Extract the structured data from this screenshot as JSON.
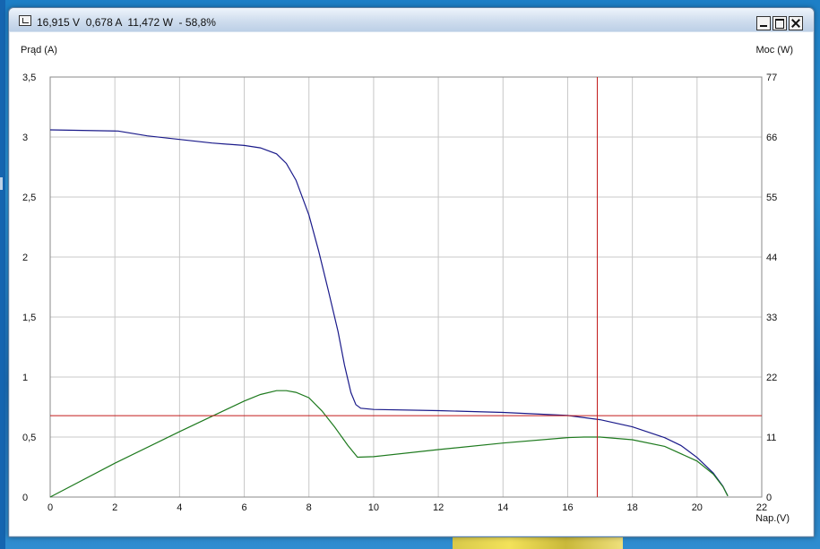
{
  "window": {
    "title": "16,915 V  0,678 A  11,472 W  - 58,8%"
  },
  "colors": {
    "current_curve": "#1a1a8a",
    "power_curve": "#1e7a1e",
    "cursor": "#c21a1a",
    "grid": "#c8c8c8",
    "axis": "#888888"
  },
  "chart_data": {
    "type": "line",
    "xlabel": "Nap.(V)",
    "ylabel_left": "Prąd (A)",
    "ylabel_right": "Moc (W)",
    "xlim": [
      0,
      22
    ],
    "ylim_left": [
      0,
      3.5
    ],
    "ylim_right": [
      0,
      77
    ],
    "x_ticks": [
      0,
      2,
      4,
      6,
      8,
      10,
      12,
      14,
      16,
      18,
      20,
      22
    ],
    "x_tick_labels": [
      "0",
      "2",
      "4",
      "6",
      "8",
      "10",
      "12",
      "14",
      "16",
      "18",
      "20",
      "22"
    ],
    "y_left_ticks": [
      0,
      0.5,
      1,
      1.5,
      2,
      2.5,
      3,
      3.5
    ],
    "y_left_tick_labels": [
      "0",
      "0,5",
      "1",
      "1,5",
      "2",
      "2,5",
      "3",
      "3,5"
    ],
    "y_right_ticks": [
      0,
      11,
      22,
      33,
      44,
      55,
      66,
      77
    ],
    "y_right_tick_labels": [
      "0",
      "11",
      "22",
      "33",
      "44",
      "55",
      "66",
      "77"
    ],
    "grid": true,
    "cursor": {
      "x": 16.915,
      "y_current": 0.678
    },
    "series": [
      {
        "axis": "left",
        "x": [
          0,
          2.1,
          3,
          4,
          5,
          6,
          6.5,
          7,
          7.3,
          7.6,
          8,
          8.3,
          8.6,
          8.9,
          9.1,
          9.3,
          9.45,
          9.6,
          10,
          12,
          14,
          16,
          17,
          18,
          19,
          19.5,
          20,
          20.5,
          20.8,
          20.95
        ],
        "y": [
          3.06,
          3.05,
          3.01,
          2.98,
          2.95,
          2.93,
          2.91,
          2.86,
          2.78,
          2.64,
          2.35,
          2.05,
          1.72,
          1.38,
          1.1,
          0.87,
          0.77,
          0.74,
          0.73,
          0.72,
          0.705,
          0.68,
          0.645,
          0.585,
          0.495,
          0.43,
          0.33,
          0.2,
          0.09,
          0.01
        ]
      },
      {
        "axis": "right",
        "x": [
          0,
          2,
          4,
          6,
          6.5,
          7,
          7.3,
          7.6,
          8,
          8.4,
          8.8,
          9.2,
          9.5,
          10,
          12,
          14,
          16,
          16.5,
          17,
          18,
          19,
          20,
          20.5,
          20.8,
          20.95
        ],
        "y": [
          0,
          6.2,
          12,
          17.6,
          18.8,
          19.5,
          19.5,
          19.2,
          18.2,
          15.8,
          12.8,
          9.5,
          7.3,
          7.4,
          8.7,
          9.9,
          10.9,
          11.0,
          11.0,
          10.5,
          9.3,
          6.6,
          4.2,
          1.9,
          0.2
        ]
      }
    ]
  }
}
